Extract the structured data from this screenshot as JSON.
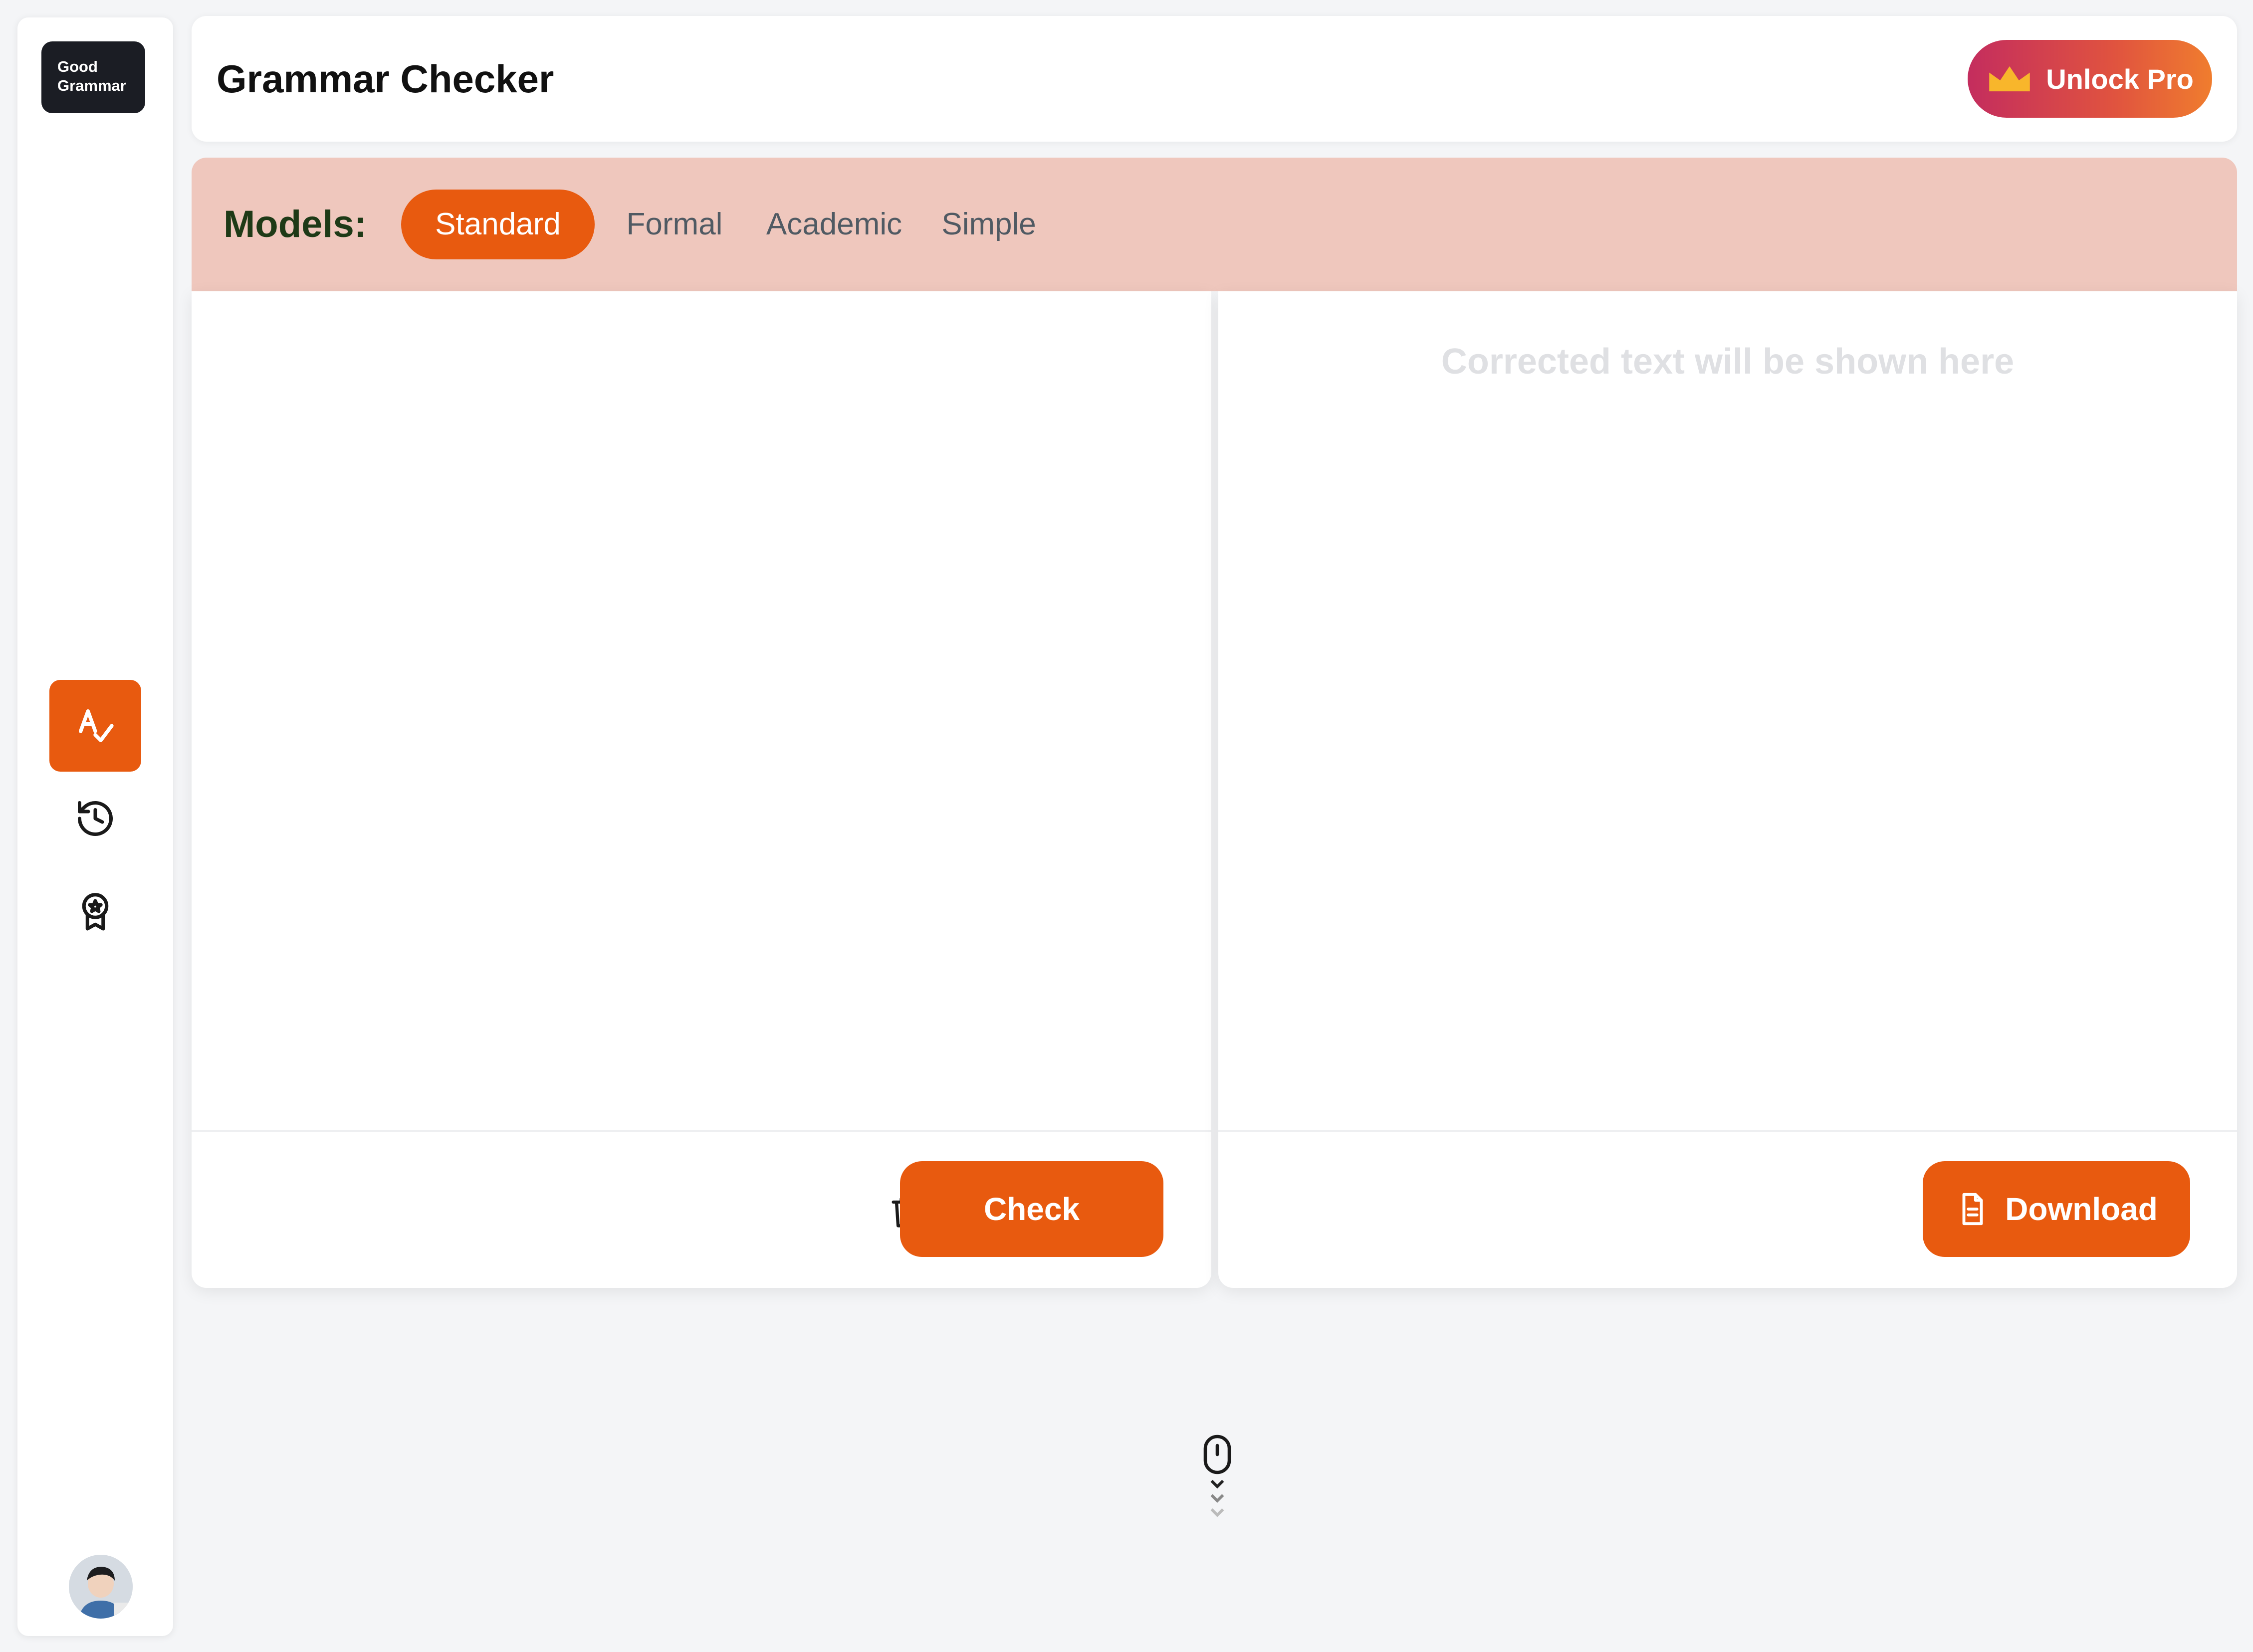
{
  "brand": {
    "logo_line1": "Good",
    "logo_line2": "Grammar"
  },
  "header": {
    "title": "Grammar Checker",
    "unlock_label": "Unlock Pro",
    "unlock_icon": "crown-icon"
  },
  "models": {
    "label": "Models:",
    "tabs": [
      {
        "label": "Standard",
        "active": true
      },
      {
        "label": "Formal",
        "active": false
      },
      {
        "label": "Academic",
        "active": false
      },
      {
        "label": "Simple",
        "active": false
      }
    ]
  },
  "sidebar": {
    "items": [
      {
        "icon": "spell-check-icon",
        "active": true
      },
      {
        "icon": "history-icon",
        "active": false
      },
      {
        "icon": "award-icon",
        "active": false
      }
    ],
    "avatar": "avatar"
  },
  "editor": {
    "input_placeholder": "",
    "delete_icon": "trash-icon",
    "upload_icon": "file-upload-icon",
    "check_label": "Check"
  },
  "output": {
    "placeholder": "Corrected text will be shown here",
    "download_label": "Download",
    "download_icon": "document-icon"
  },
  "colors": {
    "accent": "#e85a0f",
    "models_bar": "#efc7bd",
    "models_label": "#1e3a17",
    "background": "#f4f5f7"
  }
}
